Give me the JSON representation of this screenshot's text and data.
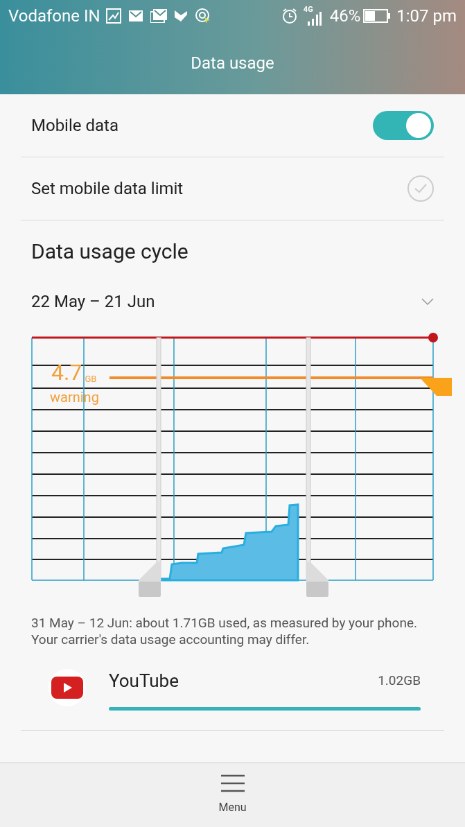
{
  "status_bar": {
    "carrier": "Vodafone IN",
    "network": "4G",
    "battery": "46%",
    "time": "1:07 pm"
  },
  "title": "Data usage",
  "settings": [
    {
      "kind": "switch",
      "label": "Mobile data",
      "on": true
    },
    {
      "kind": "check",
      "label": "Set mobile data limit",
      "checked": false
    }
  ],
  "cycle": {
    "heading": "Data usage cycle",
    "range": "22 May – 21 Jun"
  },
  "chart": {
    "warning_value": "4.7",
    "warning_unit": "GB",
    "warning_label": "warning"
  },
  "note": "31 May – 12 Jun: about 1.71GB used, as measured by your phone. Your carrier's data usage accounting may differ.",
  "apps": [
    {
      "name": "YouTube",
      "usage": "1.02GB",
      "level": 1.0
    }
  ],
  "bottom_bar": {
    "label": "Menu"
  }
}
